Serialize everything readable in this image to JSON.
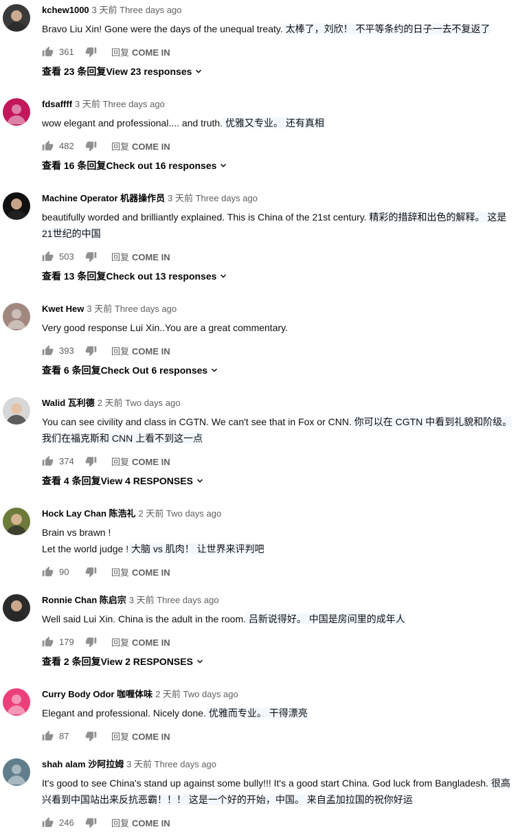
{
  "comments": [
    {
      "author": "kchew1000",
      "time": "3 天前 Three days ago",
      "lines": [
        [
          "Bravo Liu Xin! Gone were the days of the unequal treaty.",
          " 太棒了，刘欣！ 不平等条约的日子一去不复返了"
        ]
      ],
      "likes": "361",
      "reply_zh": "回复",
      "reply_en": "COME IN",
      "replies": "查看 23 条回复View 23 responses",
      "avatar_color": "#3a3a3a"
    },
    {
      "author": "fdsaffff",
      "time": "3 天前 Three days ago",
      "lines": [
        [
          "wow elegant and professional....  and truth.",
          " 优雅又专业。 还有真相"
        ]
      ],
      "likes": "482",
      "reply_zh": "回复",
      "reply_en": "COME IN",
      "replies": "查看 16 条回复Check out 16 responses",
      "avatar_color": "#c2185b"
    },
    {
      "author": "Machine Operator 机器操作员",
      "time": "3 天前 Three days ago",
      "lines": [
        [
          "beautifully worded and brilliantly explained. This is China of the 21st century.",
          " 精彩的措辞和出色的解释。 这是"
        ],
        [
          "",
          "21世纪的中国"
        ]
      ],
      "likes": "503",
      "reply_zh": "回复",
      "reply_en": "COME IN",
      "replies": "查看 13 条回复Check out 13 responses",
      "avatar_color": "#111111"
    },
    {
      "author": "Kwet Hew",
      "time": "3 天前 Three days ago",
      "lines": [
        [
          "Very good response  Lui Xin..You are a great commentary.",
          ""
        ]
      ],
      "likes": "393",
      "reply_zh": "回复",
      "reply_en": "COME IN",
      "replies": "查看 6 条回复Check Out 6 responses",
      "avatar_color": "#a1887f"
    },
    {
      "author": "Walid 瓦利德",
      "time": "2 天前 Two days ago",
      "lines": [
        [
          "You can see civility and class in CGTN. We can't see that in Fox or CNN.",
          " 你可以在 CGTN 中看到礼貌和阶级。"
        ],
        [
          "",
          "我们在福克斯和 CNN 上看不到这一点"
        ]
      ],
      "likes": "374",
      "reply_zh": "回复",
      "reply_en": "COME IN",
      "replies": "查看 4 条回复View 4 RESPONSES",
      "avatar_color": "#d7d7d7"
    },
    {
      "author": "Hock Lay Chan 陈浩礼",
      "time": "2 天前 Two days ago",
      "lines": [
        [
          "Brain vs brawn !",
          ""
        ],
        [
          "Let the world judge !",
          " 大脑 vs 肌肉！ 让世界来评判吧"
        ]
      ],
      "likes": "90",
      "reply_zh": "回复",
      "reply_en": "COME IN",
      "replies": "",
      "avatar_color": "#6d7b3a"
    },
    {
      "author": "Ronnie Chan 陈启宗",
      "time": "3 天前 Three days ago",
      "lines": [
        [
          "Well said Lui Xin. China is the adult in the room.",
          " 吕新说得好。 中国是房间里的成年人"
        ]
      ],
      "likes": "179",
      "reply_zh": "回复",
      "reply_en": "COME IN",
      "replies": "查看 2 条回复View 2 RESPONSES",
      "avatar_color": "#2b2b2b"
    },
    {
      "author": "Curry Body Odor 咖喱体味",
      "time": "2 天前 Two days ago",
      "lines": [
        [
          "Elegant and professional.  Nicely done.",
          " 优雅而专业。 干得漂亮"
        ]
      ],
      "likes": "87",
      "reply_zh": "回复",
      "reply_en": "COME IN",
      "replies": "",
      "avatar_color": "#ec407a"
    },
    {
      "author": "shah alam 沙阿拉姆",
      "time": "3 天前 Three days ago",
      "lines": [
        [
          "It's good to see China's stand up against some bully!!! It's a good start China. God luck from Bangladesh.",
          " 很高"
        ],
        [
          "",
          "兴看到中国站出来反抗恶霸！！！ 这是一个好的开始，中国。 来自孟加拉国的祝你好运"
        ]
      ],
      "likes": "246",
      "reply_zh": "回复",
      "reply_en": "COME IN",
      "replies": "",
      "avatar_color": "#607d8b"
    }
  ]
}
